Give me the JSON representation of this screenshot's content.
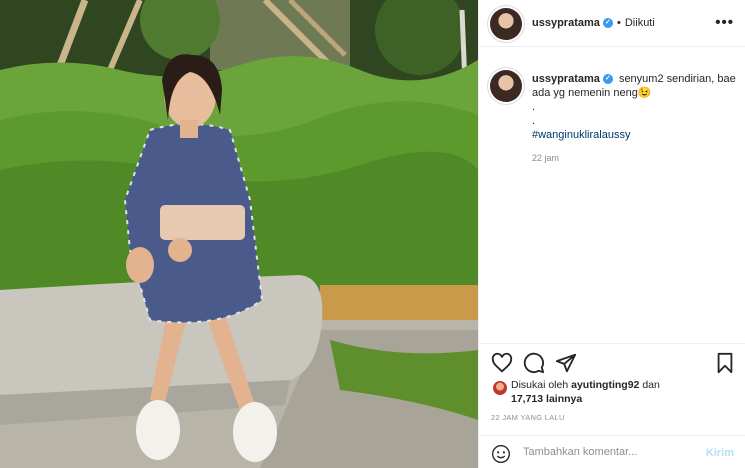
{
  "post": {
    "username": "ussypratama",
    "follow_status": "Diikuti",
    "more_icon": "more-options-icon",
    "caption": {
      "username": "ussypratama",
      "line1": "senyum2 sendirian, bae ada yg nemenin neng😉",
      "dot1": ".",
      "dot2": ".",
      "hashtag": "#wanginuklira lussy",
      "hashtag_display": "#wanginukliralaussy",
      "time": "22 jam"
    },
    "likes": {
      "prefix": "Disukai oleh",
      "liker": "ayutingting92",
      "conjunction": "dan",
      "count_text": "17,713 lainnya"
    },
    "timestamp": "22 JAM YANG LALU",
    "comment": {
      "placeholder": "Tambahkan komentar...",
      "send_label": "Kirim"
    },
    "icons": [
      "heart-icon",
      "comment-icon",
      "share-icon",
      "bookmark-icon",
      "emoji-icon"
    ],
    "colors": {
      "link": "#00376b",
      "verified": "#3897f0",
      "send_disabled": "#b2dffc"
    }
  }
}
